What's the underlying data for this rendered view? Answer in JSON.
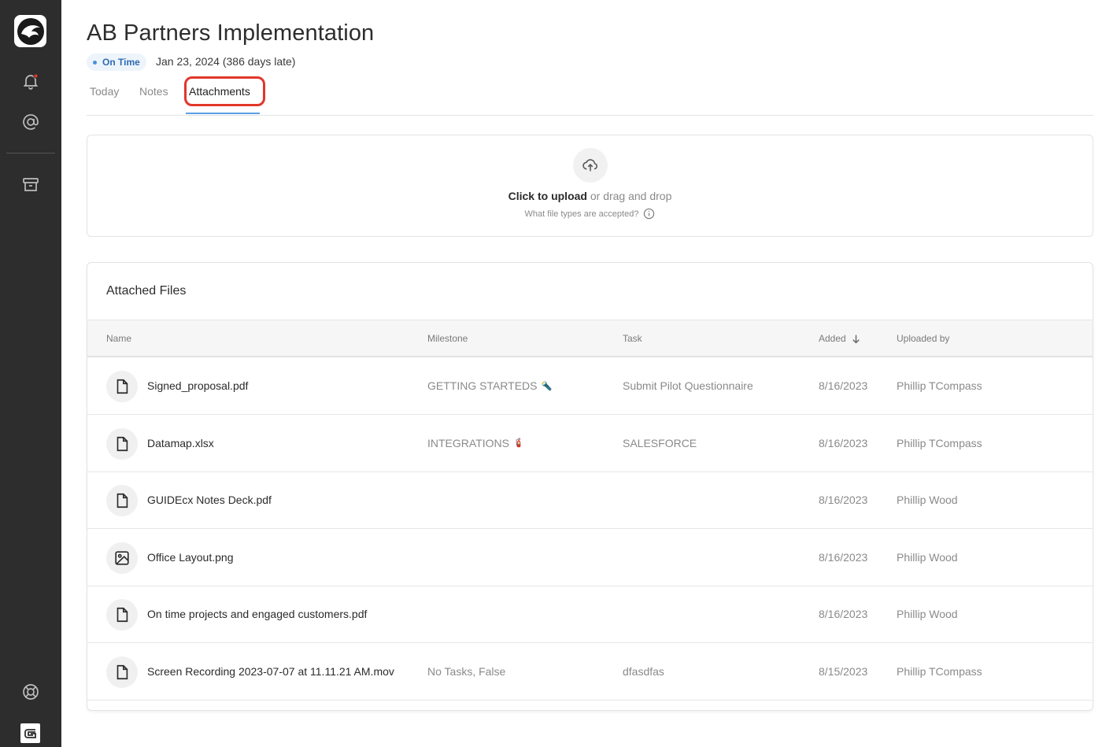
{
  "sidebar": {
    "logo": "app-logo",
    "items": [
      {
        "icon": "bell-icon",
        "has_badge": true
      },
      {
        "icon": "at-icon"
      },
      {
        "icon": "archive-icon"
      },
      {
        "icon": "lifebuoy-icon"
      }
    ],
    "brand": "guidecx-logo"
  },
  "header": {
    "title": "AB Partners Implementation",
    "status": "On Time",
    "due": "Jan 23, 2024 (386 days late)"
  },
  "tabs": [
    {
      "label": "Today",
      "active": false
    },
    {
      "label": "Notes",
      "active": false
    },
    {
      "label": "Attachments",
      "active": true
    }
  ],
  "upload": {
    "cta": "Click to upload",
    "rest": " or drag and drop",
    "help": "What file types are accepted?"
  },
  "files": {
    "title": "Attached Files",
    "columns": {
      "name": "Name",
      "milestone": "Milestone",
      "task": "Task",
      "added": "Added",
      "uploaded_by": "Uploaded by"
    },
    "sort_icon": "arrow-down-icon",
    "rows": [
      {
        "icon": "file-icon",
        "name": "Signed_proposal.pdf",
        "milestone": "GETTING STARTEDS",
        "milestone_emoji": "🔦",
        "task": "Submit Pilot Questionnaire",
        "added": "8/16/2023",
        "uploaded_by": "Phillip TCompass"
      },
      {
        "icon": "file-icon",
        "name": "Datamap.xlsx",
        "milestone": "INTEGRATIONS",
        "milestone_emoji": "🧯",
        "task": "SALESFORCE",
        "added": "8/16/2023",
        "uploaded_by": "Phillip TCompass"
      },
      {
        "icon": "file-icon",
        "name": "GUIDEcx Notes Deck.pdf",
        "milestone": "",
        "milestone_emoji": "",
        "task": "",
        "added": "8/16/2023",
        "uploaded_by": "Phillip Wood"
      },
      {
        "icon": "image-icon",
        "name": "Office Layout.png",
        "milestone": "",
        "milestone_emoji": "",
        "task": "",
        "added": "8/16/2023",
        "uploaded_by": "Phillip Wood"
      },
      {
        "icon": "file-icon",
        "name": "On time projects and engaged customers.pdf",
        "milestone": "",
        "milestone_emoji": "",
        "task": "",
        "added": "8/16/2023",
        "uploaded_by": "Phillip Wood"
      },
      {
        "icon": "file-icon",
        "name": "Screen Recording 2023-07-07 at 11.11.21 AM.mov",
        "milestone": "No Tasks, False",
        "milestone_emoji": "",
        "task": "dfasdfas",
        "added": "8/15/2023",
        "uploaded_by": "Phillip TCompass"
      }
    ]
  },
  "colors": {
    "sidebar_bg": "#2d2d2d",
    "accent": "#5aa0e6",
    "highlight": "#e0372a",
    "status_text": "#2d6cb3"
  }
}
